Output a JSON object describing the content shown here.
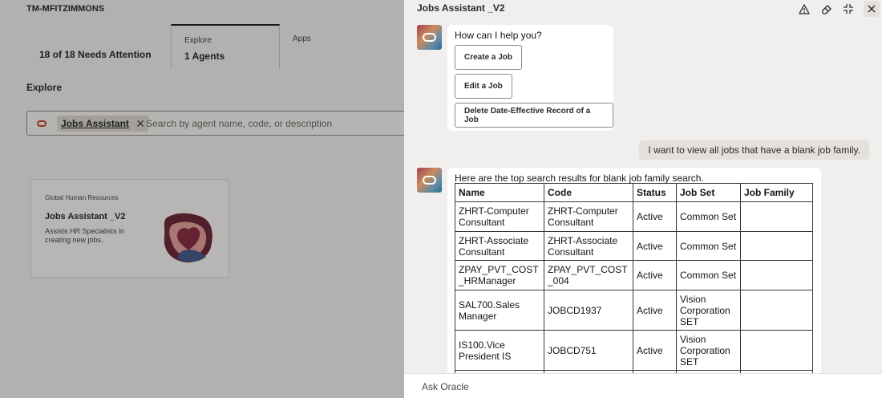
{
  "background": {
    "user_id": "TM-MFITZIMMONS",
    "tabs": [
      {
        "small": "",
        "big": "18 of 18 Needs Attention"
      },
      {
        "small": "Explore",
        "big": "1 Agents"
      },
      {
        "small": "Apps",
        "big": ""
      }
    ],
    "explore_heading": "Explore",
    "search": {
      "chip_label": "Jobs Assistant",
      "placeholder": "Search by agent name, code, or description"
    },
    "agent_card": {
      "category": "Global Human Resources",
      "name": "Jobs Assistant _V2",
      "description": "Assists HR Specialists in creating new jobs."
    }
  },
  "panel": {
    "title": "Jobs Assistant _V2",
    "header_icons": [
      "warning-icon",
      "eraser-icon",
      "collapse-icon",
      "close-icon"
    ],
    "messages": {
      "greeting": "How can I help you?",
      "actions": [
        "Create a Job",
        "Edit a Job",
        "Delete Date-Effective Record of a Job"
      ],
      "user_message": "I want to view all jobs that have a blank job family.",
      "results_intro": "Here are the top search results for blank job family search.",
      "table": {
        "columns": [
          "Name",
          "Code",
          "Status",
          "Job Set",
          "Job Family"
        ],
        "rows": [
          [
            "ZHRT-Computer Consultant",
            "ZHRT-Computer Consultant",
            "Active",
            "Common Set",
            ""
          ],
          [
            "ZHRT-Associate Consultant",
            "ZHRT-Associate Consultant",
            "Active",
            "Common Set",
            ""
          ],
          [
            "ZPAY_PVT_COST_HRManager",
            "ZPAY_PVT_COST_004",
            "Active",
            "Common Set",
            ""
          ],
          [
            "SAL700.Sales Manager",
            "JOBCD1937",
            "Active",
            "Vision Corporation SET",
            ""
          ],
          [
            "IS100.Vice President IS",
            "JOBCD751",
            "Active",
            "Vision Corporation SET",
            ""
          ],
          [
            "",
            "",
            "",
            "",
            ""
          ]
        ]
      }
    },
    "input_placeholder": "Ask Oracle"
  },
  "colors": {
    "oracle_red": "#c74634",
    "panel_bg": "#f1efed",
    "bubble_bg": "#ffffff",
    "user_bubble_bg": "#e4e1dd"
  }
}
